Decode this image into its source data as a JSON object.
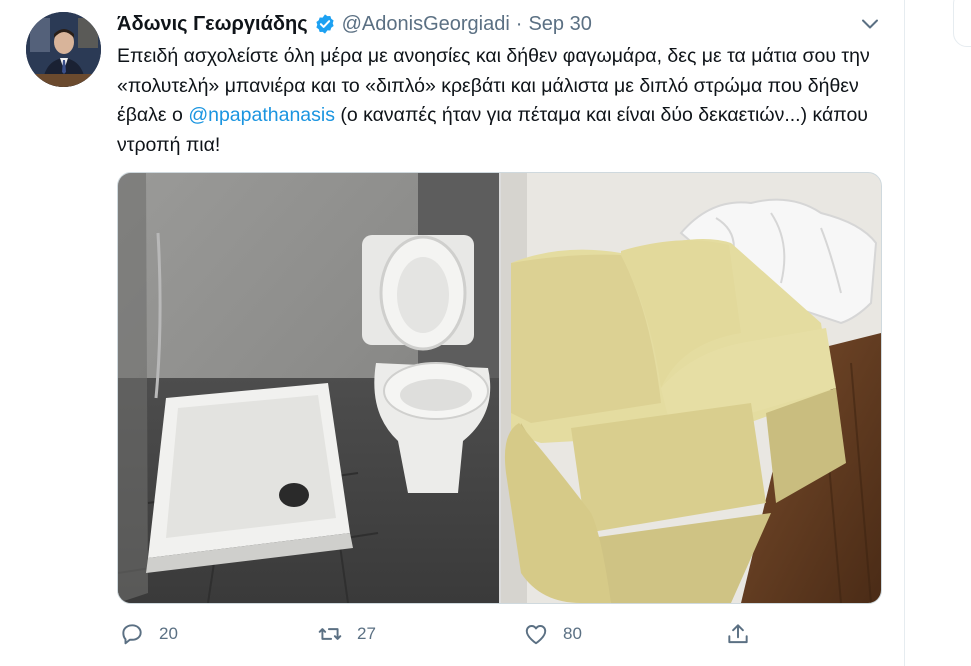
{
  "tweet": {
    "author": {
      "display_name": "Άδωνις Γεωργιάδης",
      "handle": "@AdonisGeorgiadi",
      "verified": true,
      "avatar_icon": "avatar-photo"
    },
    "separator": "·",
    "date": "Sep 30",
    "text_before_mention": "Επειδή ασχολείστε όλη μέρα με ανοησίες και δήθεν φαγωμάρα, δες με τα μάτια σου την «πολυτελή» μπανιέρα και το «διπλό» κρεβάτι και μάλιστα με διπλό στρώμα που δήθεν έβαλε ο ",
    "mention": "@npapathanasis",
    "text_after_mention": " (ο καναπές ήταν για πέταμα και είναι δύο δεκαετιών...) κάπου ντροπή πια!",
    "media": [
      {
        "icon": "bathroom-photo"
      },
      {
        "icon": "sofa-photo"
      }
    ],
    "actions": {
      "reply": {
        "icon": "reply-icon",
        "count": "20"
      },
      "retweet": {
        "icon": "retweet-icon",
        "count": "27"
      },
      "like": {
        "icon": "heart-icon",
        "count": "80"
      },
      "share": {
        "icon": "share-icon"
      }
    }
  },
  "colors": {
    "link": "#1b95e0",
    "muted": "#5b7083",
    "verified": "#1da1f2",
    "border": "#e6ecf0"
  }
}
